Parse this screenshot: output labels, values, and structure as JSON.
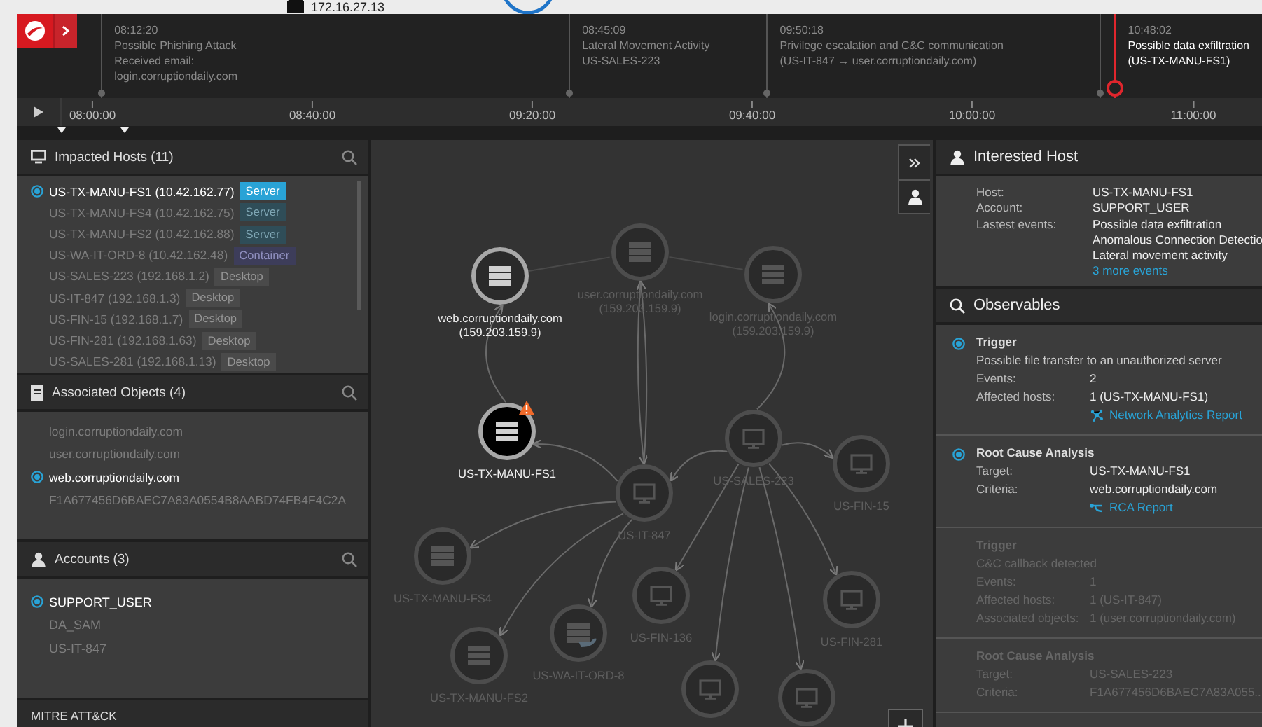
{
  "background": {
    "text": "172.16.27.13"
  },
  "timeline": {
    "events": [
      {
        "time": "08:12:20",
        "title": "Possible Phishing Attack",
        "details": [
          "Received email:",
          "login.corruptiondaily.com"
        ],
        "selected": false
      },
      {
        "time": "08:45:09",
        "title": "Lateral Movement Activity",
        "details": [
          "US-SALES-223"
        ],
        "selected": false
      },
      {
        "time": "09:50:18",
        "title": "Privilege escalation and C&C communication",
        "details": [
          "(US-IT-847 → user.corruptiondaily.com)"
        ],
        "selected": false
      },
      {
        "time": "10:48:02",
        "title": "Possible data exfiltration",
        "details": [
          "(US-TX-MANU-FS1)"
        ],
        "selected": true
      }
    ],
    "ticks": [
      "08:00:00",
      "08:40:00",
      "09:20:00",
      "09:40:00",
      "10:00:00",
      "11:00:00"
    ]
  },
  "impacted_hosts": {
    "title": "Impacted Hosts (11)",
    "items": [
      {
        "name": "US-TX-MANU-FS1 (10.42.162.77)",
        "tag": "Server",
        "kind": "server",
        "selected": true
      },
      {
        "name": "US-TX-MANU-FS4 (10.42.162.75)",
        "tag": "Server",
        "kind": "server",
        "selected": false
      },
      {
        "name": "US-TX-MANU-FS2 (10.42.162.88)",
        "tag": "Server",
        "kind": "server",
        "selected": false
      },
      {
        "name": "US-WA-IT-ORD-8 (10.42.162.48)",
        "tag": "Container",
        "kind": "container",
        "selected": false
      },
      {
        "name": "US-SALES-223 (192.168.1.2)",
        "tag": "Desktop",
        "kind": "desktop",
        "selected": false
      },
      {
        "name": "US-IT-847 (192.168.1.3)",
        "tag": "Desktop",
        "kind": "desktop",
        "selected": false
      },
      {
        "name": "US-FIN-15 (192.168.1.7)",
        "tag": "Desktop",
        "kind": "desktop",
        "selected": false
      },
      {
        "name": "US-FIN-281 (192.168.1.63)",
        "tag": "Desktop",
        "kind": "desktop",
        "selected": false
      },
      {
        "name": "US-SALES-281 (192.168.1.13)",
        "tag": "Desktop",
        "kind": "desktop",
        "selected": false
      }
    ]
  },
  "associated_objects": {
    "title": "Associated Objects (4)",
    "items": [
      {
        "name": "login.corruptiondaily.com",
        "selected": false
      },
      {
        "name": "user.corruptiondaily.com",
        "selected": false
      },
      {
        "name": "web.corruptiondaily.com",
        "selected": true
      },
      {
        "name": "F1A677456D6BAEC7A83A0554B8AABD74FB4F4C2A",
        "selected": false
      }
    ]
  },
  "accounts": {
    "title": "Accounts (3)",
    "items": [
      {
        "name": "SUPPORT_USER",
        "selected": true
      },
      {
        "name": "DA_SAM",
        "selected": false
      },
      {
        "name": "US-IT-847",
        "selected": false
      }
    ]
  },
  "mitre": {
    "title": "MITRE ATT&CK"
  },
  "graph": {
    "nodes": [
      {
        "label": "web.corruptiondaily.com",
        "address": "(159.203.159.9)",
        "kind": "server",
        "highlighted": true,
        "selected": false,
        "warning": false
      },
      {
        "label": "user.corruptiondaily.com",
        "address": "(159.203.159.9)",
        "kind": "server",
        "highlighted": false,
        "selected": false,
        "warning": false
      },
      {
        "label": "login.corruptiondaily.com",
        "address": "(159.203.159.9)",
        "kind": "server",
        "highlighted": false,
        "selected": false,
        "warning": false
      },
      {
        "label": "US-TX-MANU-FS1",
        "kind": "server",
        "highlighted": true,
        "selected": true,
        "warning": true
      },
      {
        "label": "US-IT-847",
        "kind": "desktop",
        "highlighted": false,
        "selected": false,
        "warning": false
      },
      {
        "label": "US-SALES-223",
        "kind": "desktop",
        "highlighted": false,
        "selected": false,
        "warning": false
      },
      {
        "label": "US-FIN-15",
        "kind": "desktop",
        "highlighted": false,
        "selected": false,
        "warning": false
      },
      {
        "label": "US-TX-MANU-FS4",
        "kind": "server",
        "highlighted": false,
        "selected": false,
        "warning": false
      },
      {
        "label": "US-FIN-136",
        "kind": "desktop",
        "highlighted": false,
        "selected": false,
        "warning": false
      },
      {
        "label": "US-FIN-281",
        "kind": "desktop",
        "highlighted": false,
        "selected": false,
        "warning": false
      },
      {
        "label": "US-TX-MANU-FS2",
        "kind": "server",
        "highlighted": false,
        "selected": false,
        "warning": false
      },
      {
        "label": "US-WA-IT-ORD-8",
        "kind": "container",
        "highlighted": false,
        "selected": false,
        "warning": false
      },
      {
        "kind": "desktop",
        "highlighted": false,
        "selected": false,
        "warning": false
      },
      {
        "kind": "desktop",
        "highlighted": false,
        "selected": false,
        "warning": false
      }
    ]
  },
  "interested_host": {
    "title": "Interested Host",
    "fields": [
      {
        "label": "Host:",
        "values": [
          "US-TX-MANU-FS1"
        ]
      },
      {
        "label": "Account:",
        "values": [
          "SUPPORT_USER"
        ]
      },
      {
        "label": "Lastest events:",
        "values": [
          "Possible data exfiltration",
          "Anomalous Connection Detectio",
          "Lateral movement activity"
        ]
      }
    ],
    "link": "3 more events"
  },
  "observables": {
    "title": "Observables",
    "cards": [
      {
        "kind": "trigger",
        "selected": true,
        "title": "Trigger",
        "description": "Possible file transfer to an unauthorized server",
        "fields": [
          {
            "label": "Events:",
            "value": "2"
          },
          {
            "label": "Affected hosts:",
            "value": "1  (US-TX-MANU-FS1)"
          }
        ],
        "link": "Network Analytics Report"
      },
      {
        "kind": "rca",
        "selected": true,
        "title": "Root Cause Analysis",
        "fields": [
          {
            "label": "Target:",
            "value": "US-TX-MANU-FS1"
          },
          {
            "label": "Criteria:",
            "value": "web.corruptiondaily.com"
          }
        ],
        "link": "RCA Report"
      },
      {
        "kind": "trigger",
        "selected": false,
        "title": "Trigger",
        "description": "C&C callback detected",
        "fields": [
          {
            "label": "Events:",
            "value": "1"
          },
          {
            "label": "Affected hosts:",
            "value": "1  (US-IT-847)"
          },
          {
            "label": "Associated objects:",
            "value": "1 (user.corruptiondaily.com)"
          }
        ]
      },
      {
        "kind": "rca",
        "selected": false,
        "title": "Root Cause Analysis",
        "fields": [
          {
            "label": "Target:",
            "value": "US-SALES-223"
          },
          {
            "label": "Criteria:",
            "value": "F1A677456D6BAEC7A83A055..."
          }
        ]
      }
    ]
  }
}
